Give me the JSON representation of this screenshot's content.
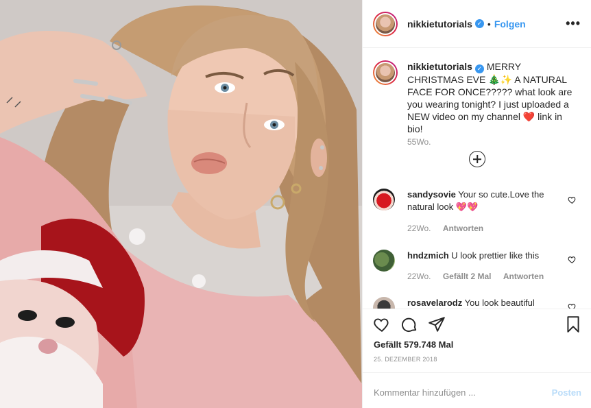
{
  "photo": {
    "alt_subject": "selfie-photo"
  },
  "header": {
    "username": "nikkietutorials",
    "separator": "•",
    "follow_label": "Folgen",
    "more_label": "•••"
  },
  "caption": {
    "username": "nikkietutorials",
    "text": "MERRY CHRISTMAS EVE 🎄✨ A NATURAL FACE FOR ONCE????? what look are you wearing tonight? I just uploaded a NEW video on my channel ❤️ link in bio!",
    "time": "55Wo."
  },
  "comments": [
    {
      "username": "sandysovie",
      "text": "Your so cute.Love the natural look 💖💖",
      "time": "22Wo.",
      "likes": "",
      "reply": "Antworten"
    },
    {
      "username": "hndzmich",
      "text": "U look prettier like this",
      "time": "22Wo.",
      "likes": "Gefällt 2 Mal",
      "reply": "Antworten"
    },
    {
      "username": "rosavelarodz",
      "text": "You look beautiful",
      "time": "",
      "likes": "",
      "reply": ""
    }
  ],
  "stats": {
    "likes": "Gefällt 579.748 Mal",
    "date": "25. DEZEMBER 2018"
  },
  "composer": {
    "placeholder": "Kommentar hinzufügen ...",
    "post_label": "Posten"
  },
  "colors": {
    "accent": "#3897f0",
    "muted": "#8e8e8e",
    "post_disabled": "#b9dcf9",
    "sweater": "#e9b4b4"
  }
}
